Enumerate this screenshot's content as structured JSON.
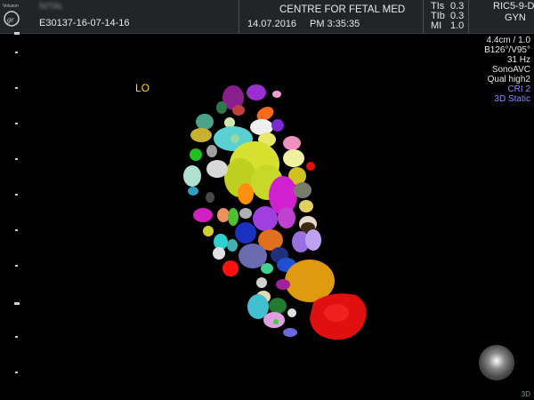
{
  "header": {
    "brand_text": "Voluson",
    "patient_name_blurred": "NITAL",
    "exam_id": "E30137-16-07-14-16",
    "institution": "CENTRE FOR FETAL MED",
    "date": "14.07.2016",
    "time": "PM 3:35:35",
    "tis_label": "TIs",
    "tis_value": "0.3",
    "tib_label": "TIb",
    "tib_value": "0.3",
    "mi_label": "MI",
    "mi_value": "1.0",
    "probe": "RIC5-9-D",
    "preset": "GYN"
  },
  "image_info": {
    "depth": "4.4cm / 1.0",
    "angle": "B126°/V95°",
    "frame_rate": "31 Hz",
    "mode": "SonoAVC",
    "quality": "Qual high2",
    "cri": "CRI 2",
    "render_mode": "3D Static"
  },
  "overlay": {
    "side_label": "LO",
    "corner_mark": "3D"
  },
  "colors": {
    "header_bg": "#222528",
    "side_label": "#ffd23a",
    "blue_info": "#8a8cff",
    "background": "#000000"
  },
  "icons": {
    "brand_logo": "ge-logo-icon",
    "orientation": "orientation-sphere-icon"
  }
}
